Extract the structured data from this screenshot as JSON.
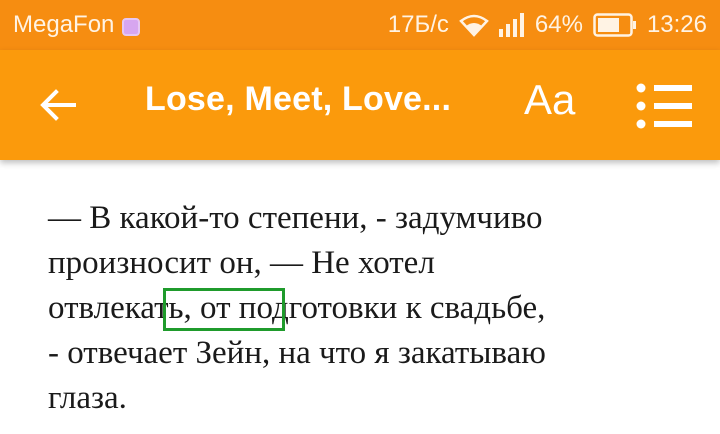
{
  "status_bar": {
    "carrier": "MegaFon",
    "speed": "17Б/с",
    "battery": "64%",
    "time": "13:26"
  },
  "app_bar": {
    "title": "Lose, Meet, Love...",
    "font_button": "Aa"
  },
  "content": {
    "lines": [
      "— В какой-то степени, - задумчиво",
      "произносит он, — Не хотел",
      "отвлекать, от подготовки к свадьбе,",
      "- отвечает Зейн, на что я закатываю",
      "глаза."
    ]
  },
  "colors": {
    "status_bar": "#f68d11",
    "app_bar": "#fb9a0c",
    "highlight": "#1f9b2c"
  }
}
